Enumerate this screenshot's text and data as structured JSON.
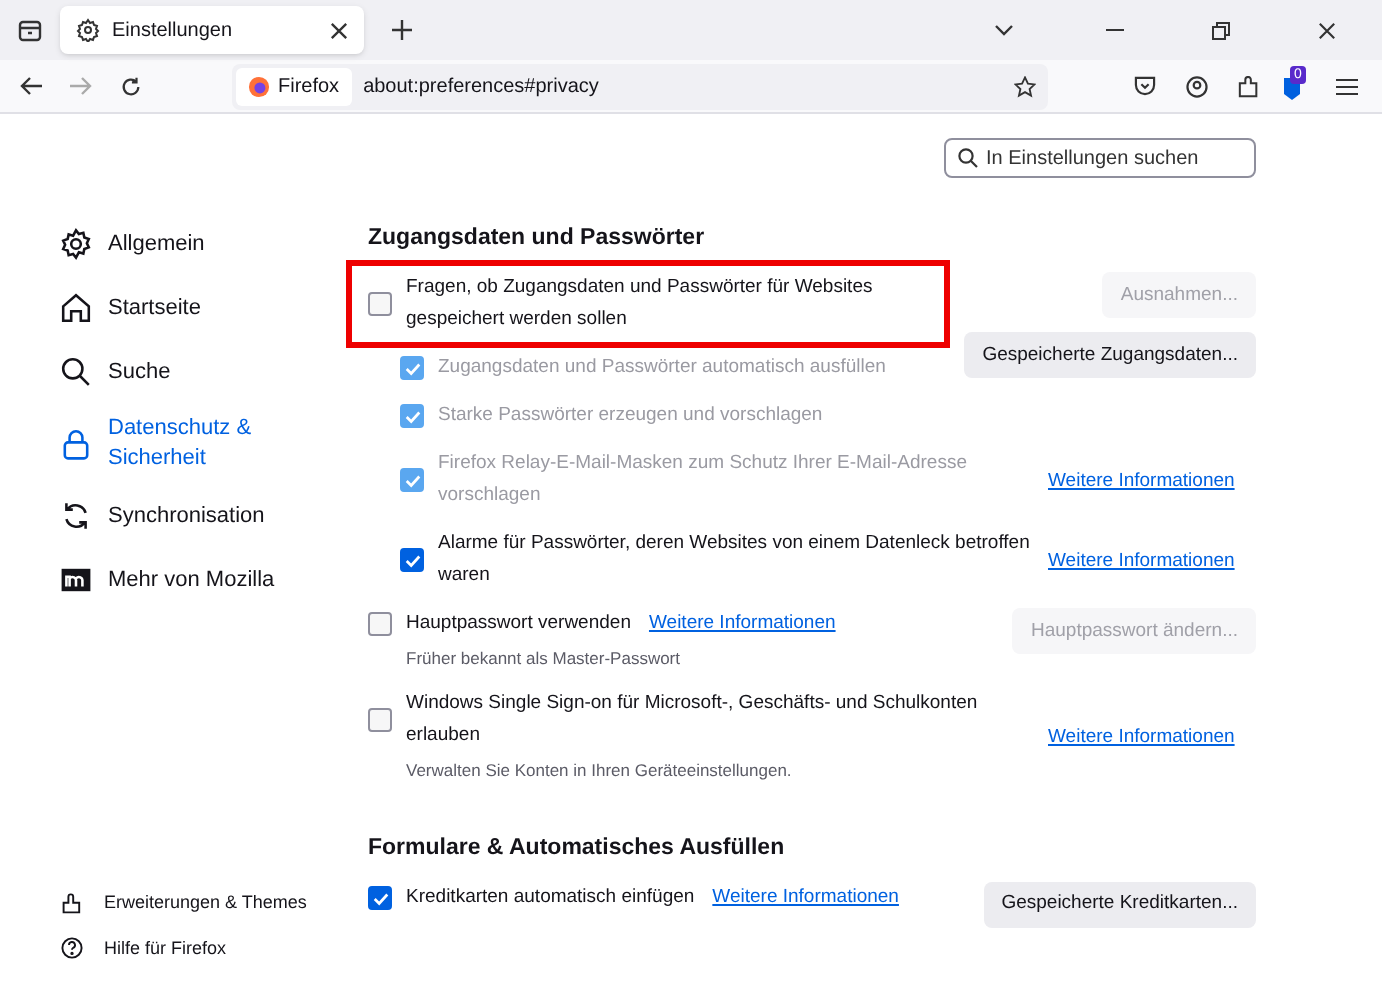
{
  "tab": {
    "title": "Einstellungen",
    "selected": true
  },
  "urlbar": {
    "identity": "Firefox",
    "url": "about:preferences#privacy"
  },
  "toolbar": {
    "badge": "0"
  },
  "search": {
    "placeholder": "In Einstellungen suchen"
  },
  "sidebar": {
    "items": [
      {
        "label": "Allgemein",
        "kind": "gear",
        "selected": false
      },
      {
        "label": "Startseite",
        "kind": "home",
        "selected": false
      },
      {
        "label": "Suche",
        "kind": "search",
        "selected": false
      },
      {
        "label": "Datenschutz & Sicherheit",
        "kind": "lock",
        "selected": true
      },
      {
        "label": "Synchronisation",
        "kind": "sync",
        "selected": false
      },
      {
        "label": "Mehr von Mozilla",
        "kind": "mozilla",
        "selected": false
      }
    ],
    "footer": [
      {
        "label": "Erweiterungen & Themes",
        "kind": "puzzle"
      },
      {
        "label": "Hilfe für Firefox",
        "kind": "help"
      }
    ]
  },
  "sections": [
    {
      "title": "Zugangsdaten und Passwörter",
      "items": [
        {
          "label": "Fragen, ob Zugangsdaten und Passwörter für Websites gespeichert werden sollen",
          "checked": false,
          "disabled": false,
          "highlighted": true,
          "button": {
            "label": "Ausnahmen...",
            "disabled": true
          },
          "children": [
            {
              "label": "Zugangsdaten und Passwörter automatisch ausfüllen",
              "checked": true,
              "disabled": true,
              "button": {
                "label": "Gespeicherte Zugangsdaten...",
                "disabled": false
              }
            },
            {
              "label": "Starke Passwörter erzeugen und vorschlagen",
              "checked": true,
              "disabled": true
            },
            {
              "label": "Firefox Relay-E-Mail-Masken zum Schutz Ihrer E-Mail-Adresse vorschlagen",
              "checked": true,
              "disabled": true,
              "link": "Weitere Informationen"
            },
            {
              "label": "Alarme für Passwörter, deren Websites von einem Datenleck betroffen waren",
              "checked": true,
              "disabled": false,
              "link": "Weitere Informationen"
            }
          ]
        },
        {
          "label": "Hauptpasswort verwenden",
          "checked": false,
          "disabled": false,
          "inline_link": "Weitere Informationen",
          "button": {
            "label": "Hauptpasswort ändern...",
            "disabled": true
          },
          "note": "Früher bekannt als Master-Passwort"
        },
        {
          "label": "Windows Single Sign-on für Microsoft-, Geschäfts- und Schulkonten erlauben",
          "checked": false,
          "disabled": false,
          "link": "Weitere Informationen",
          "note": "Verwalten Sie Konten in Ihren Geräteeinstellungen."
        }
      ]
    },
    {
      "title": "Formulare & Automatisches Ausfüllen",
      "items": [
        {
          "label": "Kreditkarten automatisch einfügen",
          "checked": true,
          "disabled": false,
          "inline_link": "Weitere Informationen",
          "button": {
            "label": "Gespeicherte Kreditkarten...",
            "disabled": false
          }
        }
      ]
    }
  ]
}
